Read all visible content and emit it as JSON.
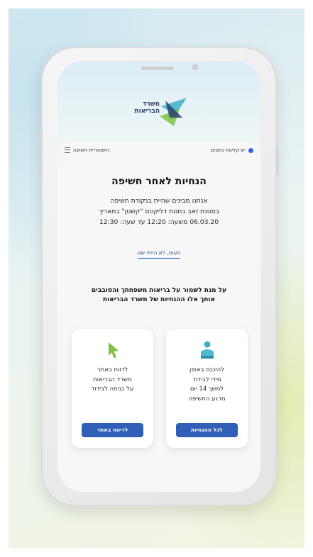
{
  "colors": {
    "accent": "#2f5fb6",
    "status_dot": "#2f6bdc",
    "logo_navy": "#2d3f6b",
    "logo_green": "#7dc242",
    "logo_teal": "#3db0c9"
  },
  "logo": {
    "line1": "משרד",
    "line2": "הבריאות"
  },
  "topbar": {
    "reception_label": "יש קליטת נתונים",
    "history_label": "היסטוריית חשיפה",
    "history_icon": "menu-icon",
    "status_icon": "blue-dot-icon"
  },
  "main": {
    "title": "הנחיות לאחר חשיפה",
    "line1": "אנחנו מבינים שהיית בנקודת חשיפה",
    "line2": "בסטנת זאב בחנות דליקטס \"קשטן\" בתאריך",
    "line3": "06.03.20 משעה: 12:20 עד שעה:",
    "line3_time": "12:30",
    "mistake_link": "טעות, לא הייתי שם"
  },
  "section": {
    "headline1": "על מנת לשמור על בריאות משפחתך והסובבים",
    "headline2": "אותך אלו ההנחיות של משרד הבריאות"
  },
  "cards": [
    {
      "icon": "person-isolation-icon",
      "lines": [
        "להיכנס באופן",
        "מידי לבידוד",
        "למשך 14 יום",
        "מרגע החשיפה"
      ],
      "button": "לכל ההנחיות"
    },
    {
      "icon": "cursor-arrow-icon",
      "lines": [
        "לדווח באתר",
        "משרד הבריאות",
        "על כניסה לבידוד"
      ],
      "button": "לדיווח באתר"
    }
  ]
}
